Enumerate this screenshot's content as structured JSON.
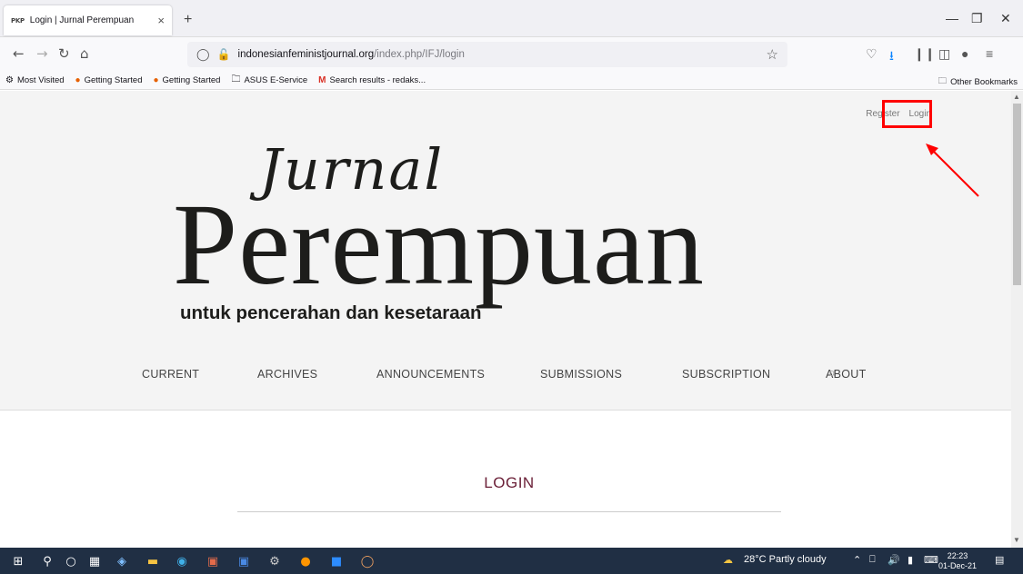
{
  "browser": {
    "tab_favicon": "PKP",
    "tab_title": "Login | Jurnal Perempuan",
    "tab_close": "×",
    "new_tab": "+",
    "url_host": "indonesianfeministjournal.org",
    "url_path": "/index.php/IFJ/login"
  },
  "bookmarks": {
    "items": [
      {
        "label": "Most Visited",
        "icon": "gear-icon"
      },
      {
        "label": "Getting Started",
        "icon": "firefox-icon"
      },
      {
        "label": "Getting Started",
        "icon": "firefox-icon"
      },
      {
        "label": "ASUS E-Service",
        "icon": "folder-icon"
      },
      {
        "label": "Search results - redaks...",
        "icon": "gmail-icon"
      }
    ],
    "other": "Other Bookmarks"
  },
  "site": {
    "user_nav": {
      "register": "Register",
      "login": "Login"
    },
    "logo": {
      "jurnal": "Jurnal",
      "perempuan": "Perempuan",
      "tagline": "untuk pencerahan dan kesetaraan"
    },
    "nav": [
      "CURRENT",
      "ARCHIVES",
      "ANNOUNCEMENTS",
      "SUBMISSIONS",
      "SUBSCRIPTION",
      "ABOUT"
    ],
    "page_title": "LOGIN",
    "annotation_color": "#ff0000",
    "title_color": "#6b2038"
  },
  "taskbar": {
    "weather": "28°C  Partly cloudy",
    "time": "22:23",
    "date": "01-Dec-21"
  }
}
